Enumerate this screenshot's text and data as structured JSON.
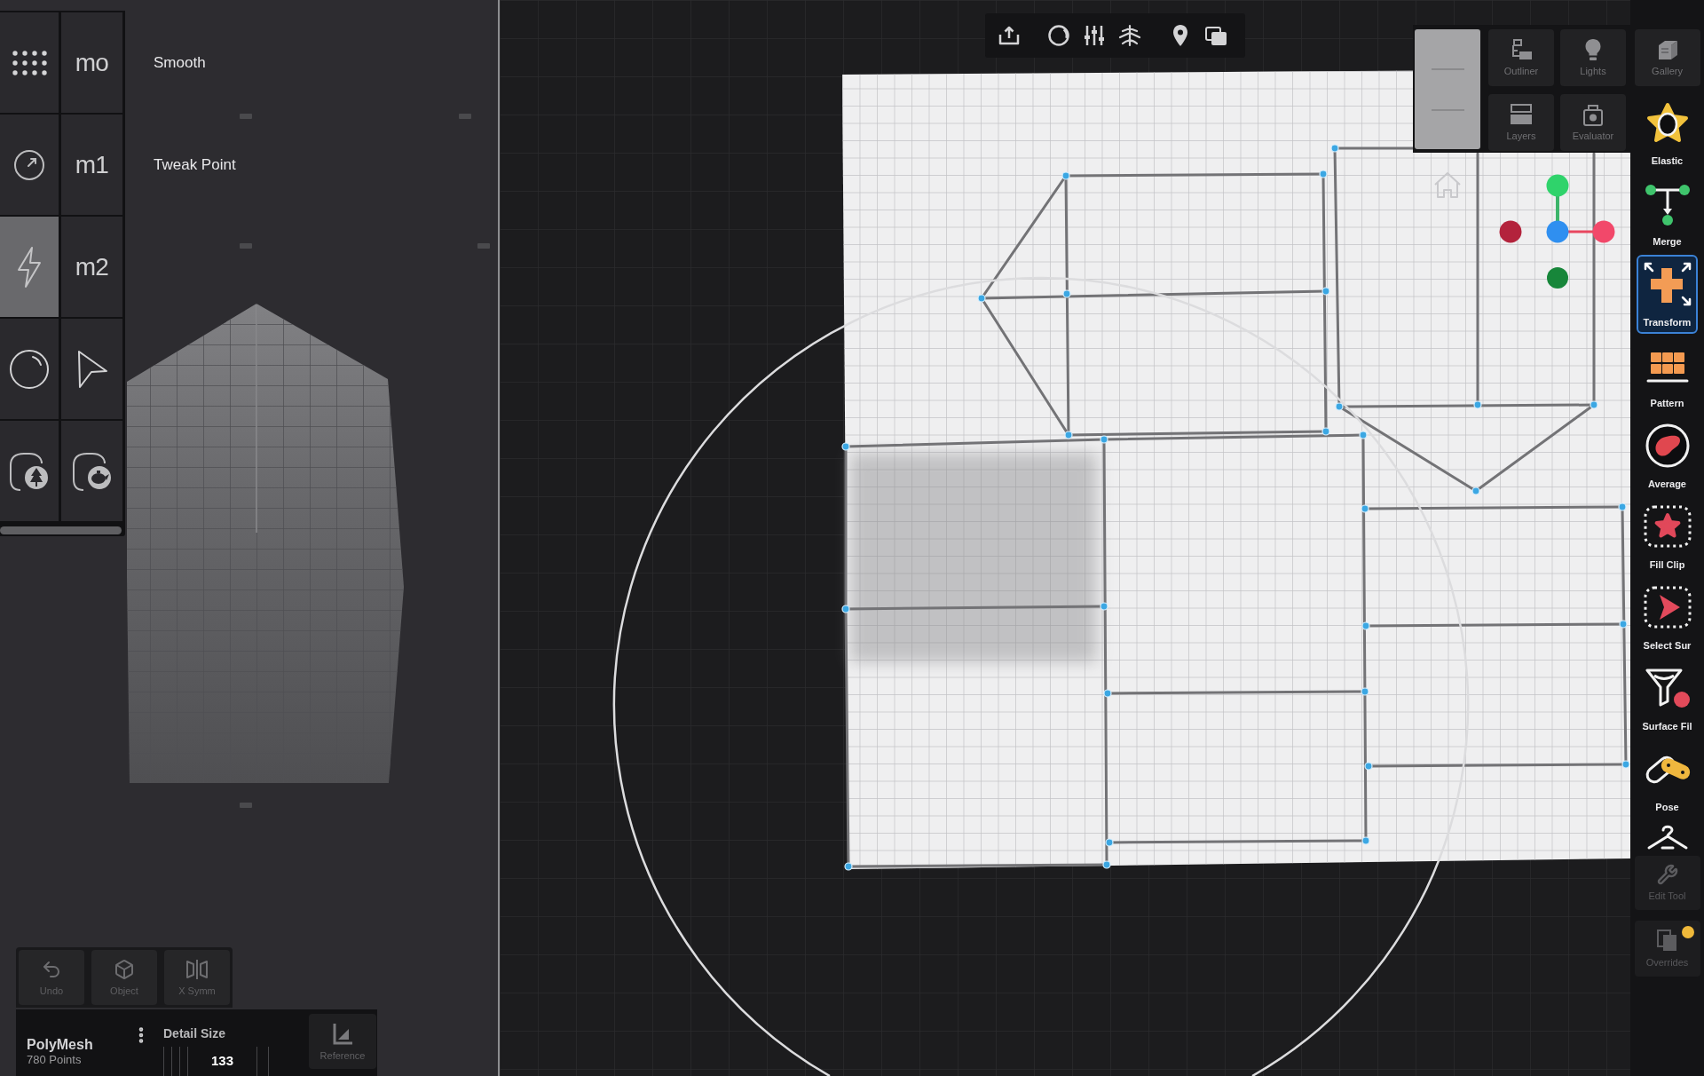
{
  "tool_grid": {
    "cells": [
      {
        "kind": "icon",
        "selected": false
      },
      {
        "kind": "text",
        "label": "mo",
        "selected": false
      },
      {
        "kind": "icon",
        "selected": false
      },
      {
        "kind": "text",
        "label": "m1",
        "selected": false
      },
      {
        "kind": "icon",
        "selected": true
      },
      {
        "kind": "text",
        "label": "m2",
        "selected": false
      },
      {
        "kind": "icon",
        "selected": false
      },
      {
        "kind": "icon",
        "selected": false
      },
      {
        "kind": "icon",
        "selected": false
      },
      {
        "kind": "icon",
        "selected": false
      }
    ]
  },
  "viewport_labels": [
    "Smooth",
    "Tweak Point"
  ],
  "quick_buttons": [
    "Undo",
    "Object",
    "X Symm"
  ],
  "object_bar": {
    "name": "PolyMesh",
    "info": "780 Points",
    "setting": {
      "label": "Detail Size",
      "value": "133"
    },
    "button": "Reference"
  },
  "panel_buttons": [
    "Outliner",
    "Lights",
    "Gallery",
    "Layers",
    "Evaluator"
  ],
  "tools": [
    {
      "label": "Elastic",
      "selected": false
    },
    {
      "label": "Merge",
      "selected": false
    },
    {
      "label": "Transform",
      "selected": true
    },
    {
      "label": "Pattern",
      "selected": false
    },
    {
      "label": "Average",
      "selected": false
    },
    {
      "label": "Fill Clip",
      "selected": false
    },
    {
      "label": "Select Sur",
      "selected": false
    },
    {
      "label": "Surface Fil",
      "selected": false
    },
    {
      "label": "Pose",
      "selected": false
    },
    {
      "selected": false
    }
  ],
  "corner_buttons": [
    {
      "label": "Edit Tool",
      "badge": false
    },
    {
      "label": "Overrides",
      "badge": true
    }
  ]
}
